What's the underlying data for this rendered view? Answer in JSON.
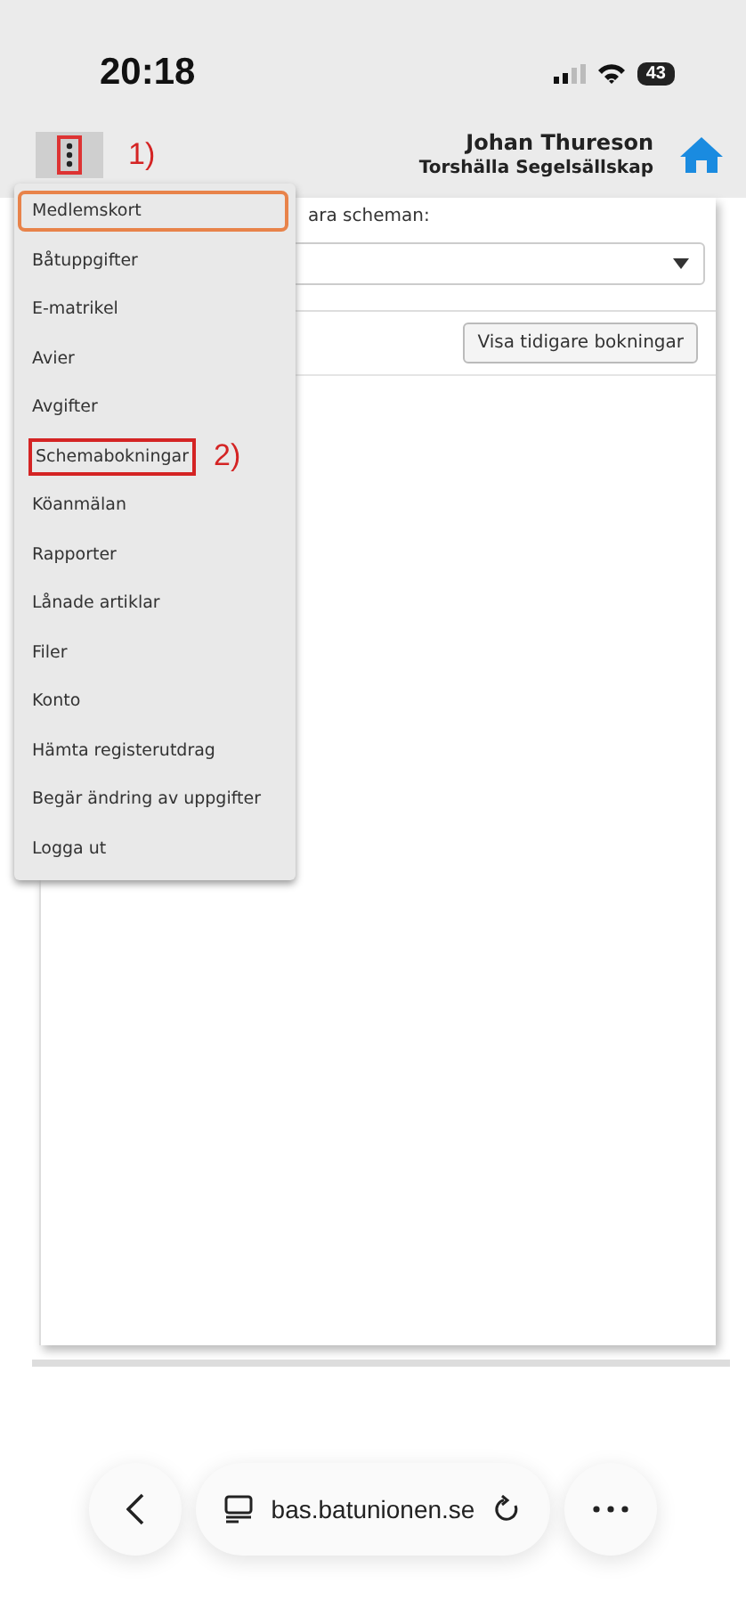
{
  "status_bar": {
    "time": "20:18",
    "battery": "43"
  },
  "header": {
    "menu_annotation": "1)",
    "user_name": "Johan Thureson",
    "club": "Torshälla Segelsällskap"
  },
  "panel": {
    "label": "ara scheman:",
    "history_button": "Visa tidigare bokningar"
  },
  "menu": {
    "items": [
      {
        "label": "Medlemskort",
        "kind": "focused"
      },
      {
        "label": "Båtuppgifter",
        "kind": "plain"
      },
      {
        "label": "E-matrikel",
        "kind": "plain"
      },
      {
        "label": "Avier",
        "kind": "plain"
      },
      {
        "label": "Avgifter",
        "kind": "plain"
      },
      {
        "label": "Schemabokningar",
        "kind": "marked",
        "annotation": "2)"
      },
      {
        "label": "Köanmälan",
        "kind": "plain"
      },
      {
        "label": "Rapporter",
        "kind": "plain"
      },
      {
        "label": "Lånade artiklar",
        "kind": "plain"
      },
      {
        "label": "Filer",
        "kind": "plain"
      },
      {
        "label": "Konto",
        "kind": "plain"
      },
      {
        "label": "Hämta registerutdrag",
        "kind": "plain"
      },
      {
        "label": "Begär ändring av uppgifter",
        "kind": "plain"
      },
      {
        "label": "Logga ut",
        "kind": "plain"
      }
    ]
  },
  "browser_bar": {
    "url": "bas.batunionen.se"
  }
}
